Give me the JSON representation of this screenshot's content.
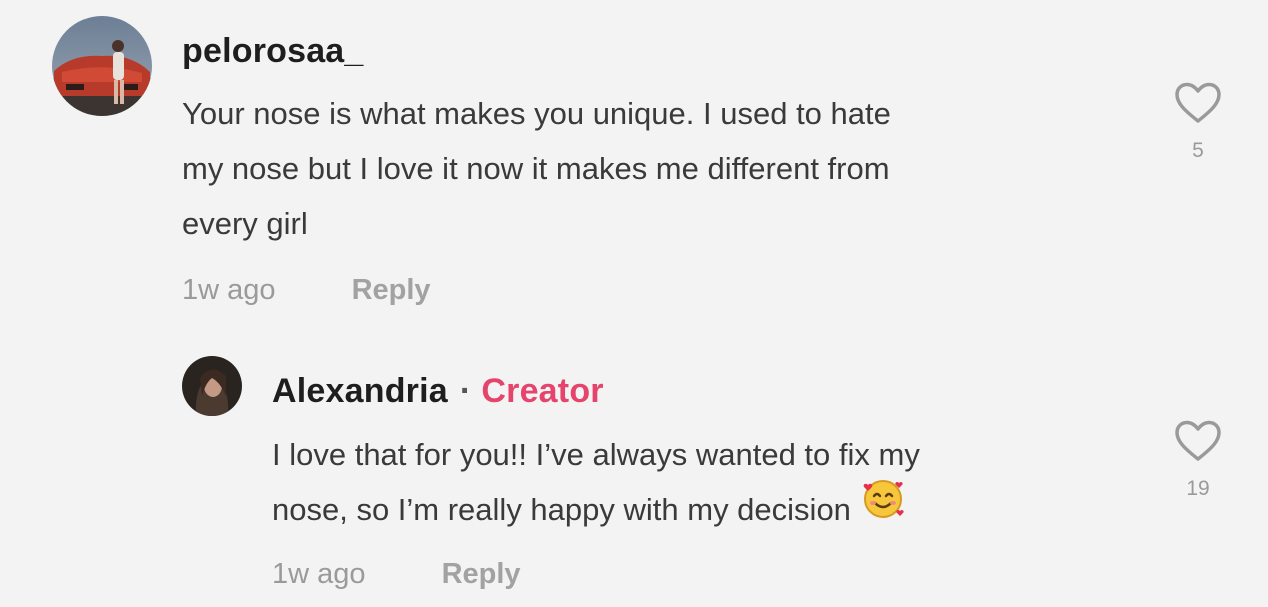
{
  "comments": [
    {
      "username": "pelorosaa_",
      "text_lines": [
        "Your nose is what makes you unique. I used to hate",
        "my nose but I love it now it makes me different from",
        "every girl"
      ],
      "time": "1w ago",
      "reply_label": "Reply",
      "likes": "5"
    }
  ],
  "reply": {
    "username": "Alexandria",
    "separator": "·",
    "badge": "Creator",
    "text_lines": [
      "I love that for you!! I’ve always wanted to fix my",
      "nose, so I’m really happy with my decision"
    ],
    "emoji": "smiling-face-with-hearts-icon",
    "time": "1w ago",
    "reply_label": "Reply",
    "likes": "19"
  },
  "colors": {
    "background": "#f3f3f3",
    "creator_badge": "#e5446d",
    "muted": "#9a9a9a"
  }
}
